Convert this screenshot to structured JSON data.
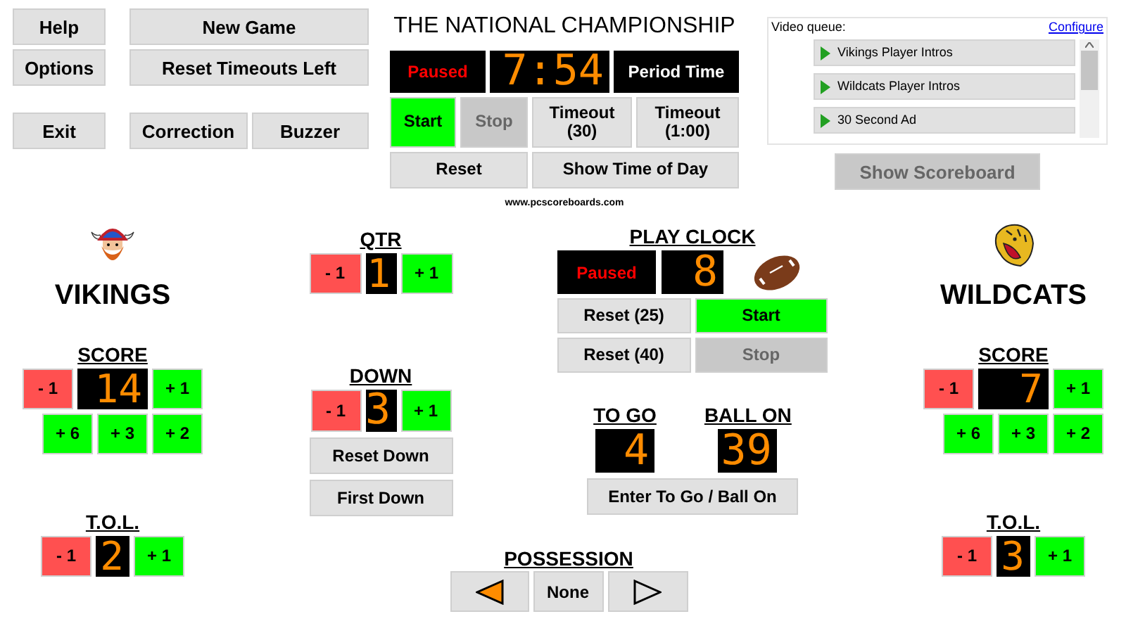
{
  "menu": {
    "rows": [
      [
        "Help",
        "New Game"
      ],
      [
        "Options",
        "Reset Timeouts Left"
      ],
      [
        "Exit",
        "Correction",
        "Buzzer"
      ]
    ]
  },
  "game_clock": {
    "title": "THE NATIONAL CHAMPIONSHIP",
    "status": "Paused",
    "time": "7:54",
    "mode": "Period Time",
    "buttons": [
      {
        "label": "Start",
        "kind": "go",
        "disabled": false
      },
      {
        "label": "Stop",
        "kind": "plain",
        "disabled": true
      },
      {
        "label": "Timeout (30)",
        "kind": "plain",
        "disabled": false
      },
      {
        "label": "Timeout (1:00)",
        "kind": "plain",
        "disabled": false
      },
      {
        "label": "Reset",
        "kind": "plain",
        "disabled": false
      },
      {
        "label": "Show Time of Day",
        "kind": "plain",
        "disabled": false
      }
    ],
    "website": "www.pcscoreboards.com"
  },
  "video_queue": {
    "label": "Video queue:",
    "configure": "Configure",
    "items": [
      {
        "label": "Vikings Player Intros"
      },
      {
        "label": "Wildcats Player Intros"
      },
      {
        "label": "30 Second Ad"
      }
    ]
  },
  "show_scoreboard": {
    "label": "Show Scoreboard",
    "disabled": true
  },
  "teams": [
    {
      "display": "VIKINGS",
      "kind": "viking",
      "score_label": "SCORE",
      "score": "14",
      "score_minus": "- 1",
      "score_plus": [
        "+ 1",
        "+ 6",
        "+ 3",
        "+ 2"
      ],
      "tol_label": "T.O.L.",
      "tol": "2",
      "tol_minus": "- 1",
      "tol_plus": "+ 1"
    },
    {
      "display": "WILDCATS",
      "kind": "wildcat",
      "score_label": "SCORE",
      "score": "7",
      "score_minus": "- 1",
      "score_plus": [
        "+ 1",
        "+ 6",
        "+ 3",
        "+ 2"
      ],
      "tol_label": "T.O.L.",
      "tol": "3",
      "tol_minus": "- 1",
      "tol_plus": "+ 1"
    }
  ],
  "qtr": {
    "label": "QTR",
    "value": "1",
    "minus": "- 1",
    "plus": "+ 1"
  },
  "down": {
    "label": "DOWN",
    "value": "3",
    "minus": "- 1",
    "plus": "+ 1",
    "buttons": [
      "Reset Down",
      "First Down"
    ]
  },
  "play_clock": {
    "label": "PLAY CLOCK",
    "status": "Paused",
    "value": "8",
    "buttons": [
      {
        "label": "Reset (25)",
        "kind": "plain",
        "disabled": false
      },
      {
        "label": "Start",
        "kind": "go",
        "disabled": false
      },
      {
        "label": "Reset (40)",
        "kind": "plain",
        "disabled": false
      },
      {
        "label": "Stop",
        "kind": "plain",
        "disabled": true
      }
    ]
  },
  "to_go": {
    "label": "TO GO",
    "value": "4"
  },
  "ball_on": {
    "label": "BALL ON",
    "value": "39"
  },
  "enter_button": "Enter To Go / Ball On",
  "possession": {
    "label": "POSSESSION",
    "options": [
      {
        "kind": "left",
        "selected": true
      },
      {
        "kind": "none",
        "label": "None",
        "selected": false
      },
      {
        "kind": "right",
        "selected": false
      }
    ]
  }
}
